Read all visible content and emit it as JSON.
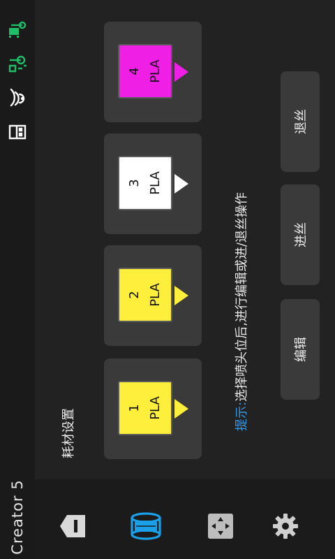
{
  "app": {
    "title": "Creator 5"
  },
  "status": {
    "icons": [
      "bed-temperature-icon",
      "nozzle-temperature-icon",
      "wifi-icon",
      "usb-icon"
    ],
    "accent": "#1fbf6a"
  },
  "page": {
    "title": "耗材设置"
  },
  "hint": {
    "prefix": "提示:",
    "text": "选择喷头位后,进行编辑或进/退丝操作"
  },
  "slots": [
    {
      "number": "1",
      "material": "PLA",
      "color": "#ffef3d"
    },
    {
      "number": "2",
      "material": "PLA",
      "color": "#ffef3d"
    },
    {
      "number": "3",
      "material": "PLA",
      "color": "#ffffff"
    },
    {
      "number": "4",
      "material": "PLA",
      "color": "#f01fe6"
    }
  ],
  "actions": {
    "edit": "编辑",
    "load": "进丝",
    "unload": "退丝"
  },
  "nav": {
    "items": [
      "back-icon",
      "filament-icon",
      "move-icon",
      "settings-icon"
    ],
    "active": "filament-icon",
    "active_color": "#1aa0e8"
  }
}
